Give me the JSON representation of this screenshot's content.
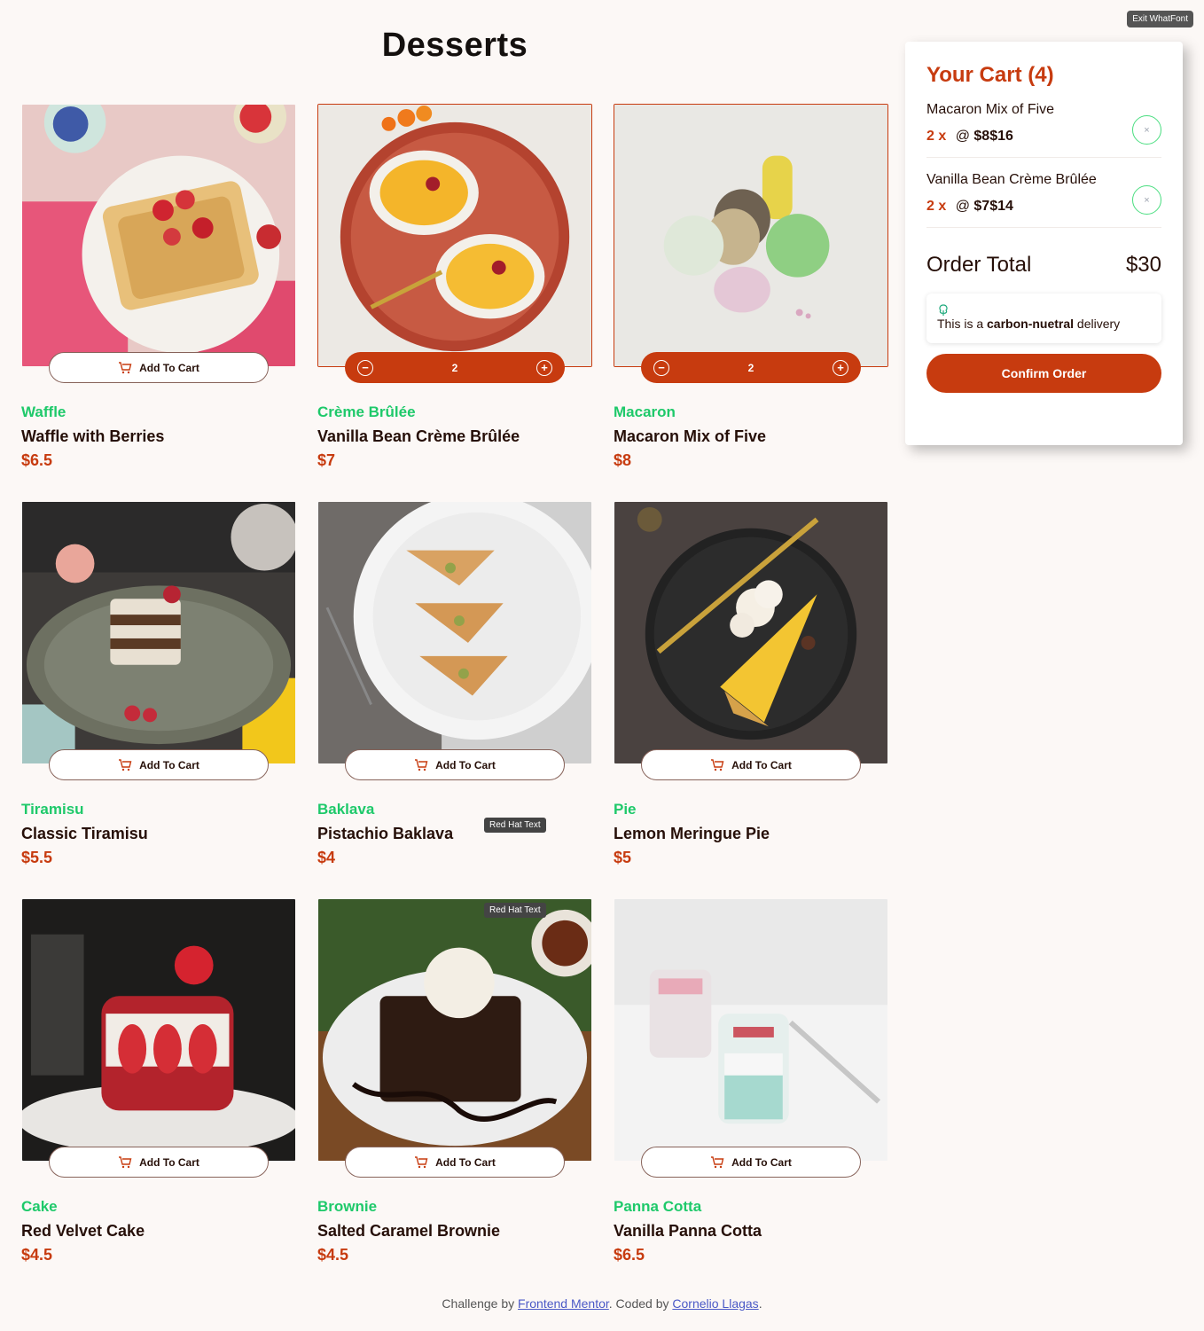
{
  "page": {
    "title": "Desserts"
  },
  "tools": {
    "exit_whatfont": "Exit WhatFont",
    "tooltip_font": "Red Hat Text"
  },
  "products": [
    {
      "category": "Waffle",
      "name": "Waffle with Berries",
      "price": "$6.5",
      "state": "add",
      "qty": "",
      "add_label": "Add To Cart"
    },
    {
      "category": "Crème Brûlée",
      "name": "Vanilla Bean Crème Brûlée",
      "price": "$7",
      "state": "qty",
      "qty": "2",
      "add_label": "Add To Cart"
    },
    {
      "category": "Macaron",
      "name": "Macaron Mix of Five",
      "price": "$8",
      "state": "qty",
      "qty": "2",
      "add_label": "Add To Cart"
    },
    {
      "category": "Tiramisu",
      "name": "Classic Tiramisu",
      "price": "$5.5",
      "state": "add",
      "qty": "",
      "add_label": "Add To Cart"
    },
    {
      "category": "Baklava",
      "name": "Pistachio Baklava",
      "price": "$4",
      "state": "add",
      "qty": "",
      "add_label": "Add To Cart"
    },
    {
      "category": "Pie",
      "name": "Lemon Meringue Pie",
      "price": "$5",
      "state": "add",
      "qty": "",
      "add_label": "Add To Cart"
    },
    {
      "category": "Cake",
      "name": "Red Velvet Cake",
      "price": "$4.5",
      "state": "add",
      "qty": "",
      "add_label": "Add To Cart"
    },
    {
      "category": "Brownie",
      "name": "Salted Caramel Brownie",
      "price": "$4.5",
      "state": "add",
      "qty": "",
      "add_label": "Add To Cart"
    },
    {
      "category": "Panna Cotta",
      "name": "Vanilla Panna Cotta",
      "price": "$6.5",
      "state": "add",
      "qty": "",
      "add_label": "Add To Cart"
    }
  ],
  "cart": {
    "title": "Your Cart (4)",
    "items": [
      {
        "name": "Macaron Mix of Five",
        "qty": "2 x",
        "at": "@",
        "unit": "$8",
        "total": "$16",
        "remove": "×"
      },
      {
        "name": "Vanilla Bean Crème Brûlée",
        "qty": "2 x",
        "at": "@",
        "unit": "$7",
        "total": "$14",
        "remove": "×"
      }
    ],
    "order_total_label": "Order Total",
    "order_total_value": "$30",
    "carbon_pre": "This is a",
    "carbon_bold": "carbon-nuetral",
    "carbon_post": "delivery",
    "confirm_label": "Confirm Order"
  },
  "footer": {
    "text1": "Challenge by",
    "link1": "Frontend Mentor",
    "text2": ". Coded by",
    "link2": "Cornelio Llagas",
    "text3": "."
  },
  "colors": {
    "accent": "#c73b0f",
    "category": "#1ec96a",
    "background": "#fcf8f6"
  }
}
